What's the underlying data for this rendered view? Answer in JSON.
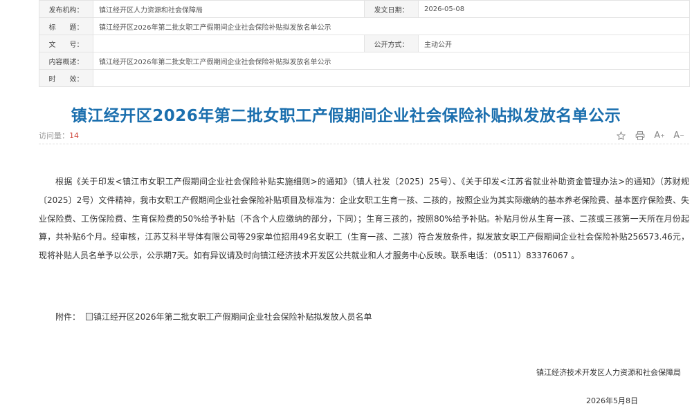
{
  "meta": {
    "publisher_label": "发布机构：",
    "publisher": "镇江经开区人力资源和社会保障局",
    "date_label": "发文日期：",
    "date": "2026-05-08",
    "title_label": "标　　题：",
    "title": "镇江经开区2026年第二批女职工产假期间企业社会保险补贴拟发放名单公示",
    "docno_label": "文　　号：",
    "docno": "",
    "public_label": "公开方式：",
    "public": "主动公开",
    "summary_label": "内容概述：",
    "summary": "镇江经开区2026年第二批女职工产假期间企业社会保险补贴拟发放名单公示",
    "validity_label": "时　　效：",
    "validity": ""
  },
  "article": {
    "title": "镇江经开区2026年第二批女职工产假期间企业社会保险补贴拟发放名单公示",
    "visits_label": "访问量：",
    "visits": "14",
    "body": "根据《关于印发<镇江市女职工产假期间企业社会保险补贴实施细则>的通知》（镇人社发〔2025〕25号）、《关于印发<江苏省就业补助资金管理办法>的通知》（苏财规〔2025〕2号）文件精神，我市女职工产假期间企业社会保险补贴项目及标准为：企业女职工生育一孩、二孩的，按照企业为其实际缴纳的基本养老保险费、基本医疗保险费、失业保险费、工伤保险费、生育保险费的50%给予补贴（不含个人应缴纳的部分，下同）；生育三孩的，按照80%给予补贴。补贴月份从生育一孩、二孩或三孩第一天所在月份起算，共补贴6个月。经审核，江苏艾科半导体有限公司等29家单位招用49名女职工（生育一孩、二孩）符合发放条件，拟发放女职工产假期间企业社会保险补贴256573.46元，现将补贴人员名单予以公示，公示期7天。如有异议请及时向镇江经济技术开发区公共就业和人才服务中心反映。联系电话：（0511）83376067 。",
    "attachment_label": "附件：",
    "attachment": "镇江经开区2026年第二批女职工产假期间企业社会保险补贴拟发放人员名单",
    "signature": "镇江经济技术开发区人力资源和社会保障局",
    "sign_date": "2026年5月8日"
  },
  "tools": {
    "favorite_icon": "star-outline-icon",
    "print_icon": "printer-icon",
    "font_up_icon": "font-increase-icon",
    "font_down_icon": "font-decrease-icon"
  }
}
